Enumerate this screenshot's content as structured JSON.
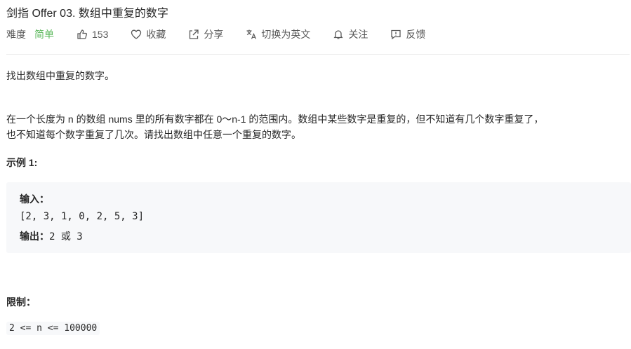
{
  "problem": {
    "title": "剑指 Offer 03. 数组中重复的数字"
  },
  "toolbar": {
    "difficulty_label": "难度",
    "difficulty_value": "简单",
    "like_count": "153",
    "favorite_label": "收藏",
    "share_label": "分享",
    "translate_label": "切换为英文",
    "follow_label": "关注",
    "feedback_label": "反馈"
  },
  "colors": {
    "difficulty_easy": "#5cb85c",
    "code_bg": "#f7f8fa",
    "divider": "#ececec"
  },
  "icons": {
    "like": "thumbs-up-icon",
    "favorite": "heart-icon",
    "share": "share-icon",
    "translate": "translate-icon",
    "follow": "bell-icon",
    "feedback": "feedback-icon"
  },
  "content": {
    "intro": "找出数组中重复的数字。",
    "description_line1": "在一个长度为 n 的数组 nums 里的所有数字都在 0～n-1 的范围内。数组中某些数字是重复的，但不知道有几个数字重复了，",
    "description_line2": "也不知道每个数字重复了几次。请找出数组中任意一个重复的数字。",
    "example_heading": "示例 1:",
    "example": {
      "input_label": "输入：",
      "input_value": "[2, 3, 1, 0, 2, 5, 3]",
      "output_label": "输出：",
      "output_value": "2 或 3"
    },
    "limit_heading": "限制：",
    "limit_value": "2 <= n <= 100000"
  }
}
